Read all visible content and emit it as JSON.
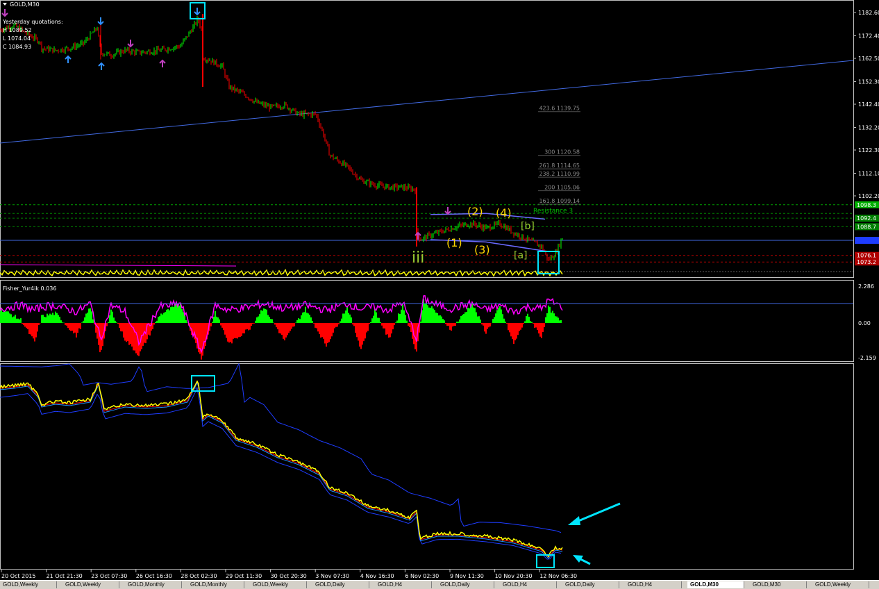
{
  "symbol_title": "GOLD,M30",
  "yesterday": {
    "header": "Yesterday quotations:",
    "high": "H 1089.52",
    "low": "L 1074.04",
    "close": "C 1084.93"
  },
  "fisher_label": "Fisher_Yur4ik 0.036",
  "resistance_label": "Resistance 3",
  "colors": {
    "background": "#000000",
    "grid": "#c0c0c0",
    "candle_up": "#00ff00",
    "candle_down": "#ff0000",
    "trendline": "#4169e1",
    "marker_box": "#00e5ff",
    "fisher_positive": "#00ff00",
    "fisher_negative": "#ff0000",
    "fisher_line": "#ff00ff",
    "price_line": "#ffff00",
    "band": "#1e3cff"
  },
  "chart_data": [
    {
      "type": "line",
      "panel": "price",
      "title": "GOLD,M30",
      "y_ticks": [
        1182.6,
        1172.4,
        1162.5,
        1152.3,
        1142.4,
        1132.2,
        1122.3,
        1112.1,
        1102.2
      ],
      "x_ticks": [
        "20 Oct 2015",
        "21 Oct 21:30",
        "23 Oct 07:30",
        "26 Oct 16:30",
        "28 Oct 02:30",
        "29 Oct 11:30",
        "30 Oct 20:30",
        "3 Nov 07:30",
        "4 Nov 16:30",
        "6 Nov 02:30",
        "9 Nov 11:30",
        "10 Nov 20:30",
        "12 Nov 06:30"
      ],
      "x": [
        0,
        20,
        40,
        57,
        60,
        80,
        100,
        120,
        140,
        145,
        160,
        180,
        200,
        230,
        260,
        280,
        285,
        290,
        292,
        300,
        320,
        330,
        350,
        370,
        390,
        410,
        430,
        455,
        465,
        475,
        500,
        520,
        540,
        560,
        580,
        598,
        600,
        605,
        620,
        640,
        660,
        680,
        700,
        720,
        740,
        760,
        780,
        790,
        800,
        810
      ],
      "y": [
        1175,
        1177,
        1173,
        1170,
        1167,
        1166,
        1167,
        1169,
        1176,
        1165,
        1164,
        1166,
        1165,
        1166,
        1168,
        1177,
        1180,
        1175,
        1163,
        1162,
        1159,
        1150,
        1147,
        1143,
        1141,
        1142,
        1138,
        1138,
        1130,
        1120,
        1115,
        1109,
        1107,
        1106,
        1106,
        1105,
        1087,
        1083,
        1085,
        1087,
        1089,
        1090,
        1088,
        1090,
        1086,
        1083,
        1080,
        1074,
        1077,
        1084
      ],
      "fibonacci_levels": [
        {
          "label": "423.6 1139.75",
          "value": 1139.75
        },
        {
          "label": "300 1120.58",
          "value": 1120.58
        },
        {
          "label": "261.8 1114.65",
          "value": 1114.65
        },
        {
          "label": "238.2 1110.99",
          "value": 1110.99
        },
        {
          "label": "200 1105.06",
          "value": 1105.06
        },
        {
          "label": "161.8 1099.14",
          "value": 1099.14
        }
      ],
      "right_labels": [
        {
          "text": "1098.3",
          "value": 1098.3,
          "color": "#00b000"
        },
        {
          "text": "1092.4",
          "value": 1092.4,
          "color": "#008000"
        },
        {
          "text": "1088.7",
          "value": 1088.7,
          "color": "#008000"
        },
        {
          "text": "1076.1",
          "value": 1076.1,
          "color": "#b00000"
        },
        {
          "text": "1073.2",
          "value": 1073.2,
          "color": "#b00000"
        }
      ],
      "wave_labels": [
        "(1)",
        "(2)",
        "(3)",
        "(4)",
        "iii",
        "[a]",
        "[b]"
      ]
    },
    {
      "type": "area",
      "panel": "fisher",
      "title": "Fisher_Yur4ik 0.036",
      "y_ticks": [
        2.286,
        0.0,
        -2.159
      ],
      "x": [
        0,
        30,
        50,
        60,
        80,
        110,
        130,
        145,
        160,
        180,
        200,
        230,
        260,
        290,
        310,
        330,
        360,
        380,
        410,
        440,
        470,
        500,
        520,
        540,
        560,
        580,
        600,
        610,
        630,
        650,
        680,
        700,
        720,
        740,
        760,
        780,
        790,
        800,
        810
      ],
      "values": [
        0.9,
        0.2,
        -1.2,
        0.4,
        0.6,
        -0.8,
        1.0,
        -1.9,
        0.8,
        -1.0,
        -2.0,
        0.5,
        1.2,
        -2.2,
        0.7,
        -1.3,
        -0.3,
        1.0,
        -1.1,
        0.9,
        -1.4,
        1.0,
        -1.6,
        0.8,
        -1.0,
        1.1,
        -1.8,
        1.4,
        0.6,
        -0.4,
        1.2,
        -0.6,
        1.0,
        -1.3,
        0.5,
        -0.9,
        1.0,
        0.4,
        0.0
      ],
      "signal": [
        0.9,
        1.1,
        0.8,
        1.0,
        1.1,
        0.7,
        1.2,
        -1.0,
        1.1,
        0.7,
        -1.2,
        1.0,
        1.2,
        -1.8,
        1.1,
        0.8,
        1.0,
        1.2,
        0.9,
        1.1,
        0.8,
        1.2,
        0.9,
        1.0,
        0.8,
        1.3,
        -1.0,
        1.5,
        1.1,
        0.9,
        1.2,
        0.8,
        1.1,
        0.7,
        1.0,
        0.9,
        1.4,
        1.2,
        1.0
      ]
    },
    {
      "type": "line",
      "panel": "lower",
      "x": [
        0,
        20,
        40,
        55,
        60,
        80,
        100,
        130,
        142,
        150,
        180,
        210,
        240,
        270,
        285,
        292,
        300,
        320,
        340,
        370,
        400,
        430,
        460,
        475,
        500,
        530,
        560,
        590,
        600,
        605,
        630,
        660,
        700,
        740,
        780,
        790,
        800,
        810
      ],
      "y": [
        557,
        555,
        552,
        568,
        582,
        578,
        580,
        575,
        550,
        590,
        582,
        584,
        582,
        575,
        545,
        602,
        595,
        605,
        630,
        640,
        655,
        665,
        680,
        702,
        710,
        728,
        735,
        745,
        735,
        775,
        768,
        768,
        772,
        778,
        790,
        800,
        788,
        790
      ],
      "series": [
        {
          "color": "#ffff00",
          "role": "price"
        },
        {
          "color": "#ff0000",
          "role": "fast"
        },
        {
          "color": "#1e90ff",
          "role": "slow"
        },
        {
          "color": "#1e3cff",
          "role": "upper-band"
        },
        {
          "color": "#1e3cff",
          "role": "lower-band"
        }
      ]
    }
  ],
  "tabs": [
    {
      "label": "GOLD,Weekly"
    },
    {
      "label": "GOLD,Weekly"
    },
    {
      "label": "GOLD,Monthly"
    },
    {
      "label": "GOLD,Monthly"
    },
    {
      "label": "GOLD,Weekly"
    },
    {
      "label": "GOLD,Daily"
    },
    {
      "label": "GOLD,H4"
    },
    {
      "label": "GOLD,Daily"
    },
    {
      "label": "GOLD,H4"
    },
    {
      "label": "GOLD,Daily"
    },
    {
      "label": "GOLD,H4"
    },
    {
      "label": "GOLD,M30"
    },
    {
      "label": "GOLD,M30"
    },
    {
      "label": "GOLD,Weekly"
    }
  ]
}
